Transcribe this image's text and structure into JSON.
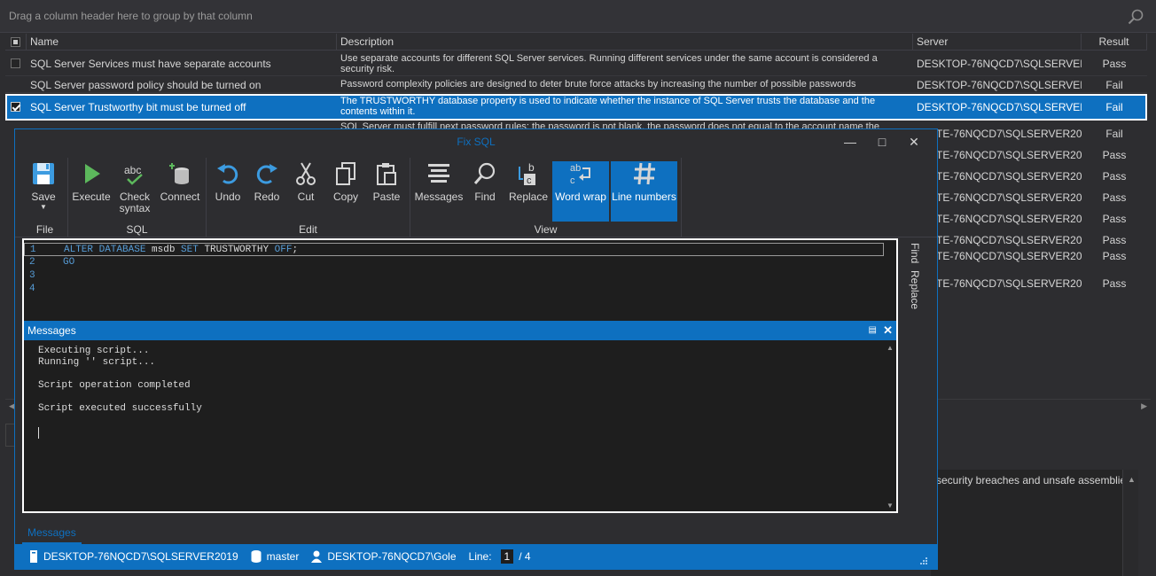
{
  "grid": {
    "group_hint": "Drag a column header here to group by that column",
    "columns": {
      "name": "Name",
      "description": "Description",
      "server": "Server",
      "result": "Result"
    },
    "rows": [
      {
        "name": "SQL Server Services must have separate accounts",
        "description": "Use separate accounts for different SQL Server services. Running different services under the same account is considered a security risk.",
        "server": "DESKTOP-76NQCD7\\SQLSERVER2019",
        "result": "Pass"
      },
      {
        "name": "SQL Server password policy should be turned on",
        "description": "Password complexity policies are designed to deter brute force attacks by increasing the number of possible passwords",
        "server": "DESKTOP-76NQCD7\\SQLSERVER2019",
        "result": "Fail"
      },
      {
        "name": "SQL Server Trustworthy bit must be turned off",
        "description": "The TRUSTWORTHY database property is used to indicate whether the instance of SQL Server trusts the database and the contents within it.",
        "server": "DESKTOP-76NQCD7\\SQLSERVER2019",
        "result": "Fail"
      }
    ],
    "partial_description": "SQL Server must fulfill next password rules: the password is not blank, the password does not equal to the account name the",
    "hidden_rows": [
      {
        "server": "TE-76NQCD7\\SQLSERVER2019",
        "result": "Fail"
      },
      {
        "server": "TE-76NQCD7\\SQLSERVER2019",
        "result": "Pass"
      },
      {
        "server": "TE-76NQCD7\\SQLSERVER2019",
        "result": "Pass"
      },
      {
        "server": "TE-76NQCD7\\SQLSERVER2019",
        "result": "Pass"
      },
      {
        "server": "TE-76NQCD7\\SQLSERVER2019",
        "result": "Pass"
      },
      {
        "server": "TE-76NQCD7\\SQLSERVER2019",
        "result": "Pass"
      },
      {
        "server": "TE-76NQCD7\\SQLSERVER2019",
        "result": "Pass"
      },
      {
        "server": "TE-76NQCD7\\SQLSERVER2019",
        "result": "Pass"
      }
    ]
  },
  "lower_panel_text": "security breaches and unsafe assemblies",
  "dialog": {
    "title": "Fix SQL",
    "ribbon": {
      "file": {
        "label": "File",
        "save": "Save"
      },
      "sql": {
        "label": "SQL",
        "execute": "Execute",
        "check_syntax_1": "Check",
        "check_syntax_2": "syntax",
        "connect": "Connect"
      },
      "edit": {
        "label": "Edit",
        "undo": "Undo",
        "redo": "Redo",
        "cut": "Cut",
        "copy": "Copy",
        "paste": "Paste"
      },
      "view": {
        "label": "View",
        "messages": "Messages",
        "find": "Find",
        "replace": "Replace",
        "word_wrap": "Word wrap",
        "line_numbers": "Line numbers"
      }
    },
    "editor": {
      "lines": [
        {
          "n": "1",
          "kw1": "ALTER DATABASE",
          "t1": " msdb ",
          "kw2": "SET",
          "t2": " TRUSTWORTHY ",
          "kw3": "OFF",
          "t3": ";"
        },
        {
          "n": "2",
          "kw1": "GO"
        },
        {
          "n": "3"
        },
        {
          "n": "4"
        }
      ]
    },
    "side_tabs": {
      "find": "Find",
      "replace": "Replace"
    },
    "messages": {
      "title": "Messages",
      "lines": [
        "Executing script...",
        "Running '' script...",
        "",
        "Script operation completed",
        "",
        "Script executed successfully"
      ]
    },
    "bottom_tab": "Messages",
    "status": {
      "server": "DESKTOP-76NQCD7\\SQLSERVER2019",
      "database": "master",
      "user": "DESKTOP-76NQCD7\\Gole",
      "line_label": "Line:",
      "line_value": "1",
      "line_total": "/ 4"
    }
  }
}
